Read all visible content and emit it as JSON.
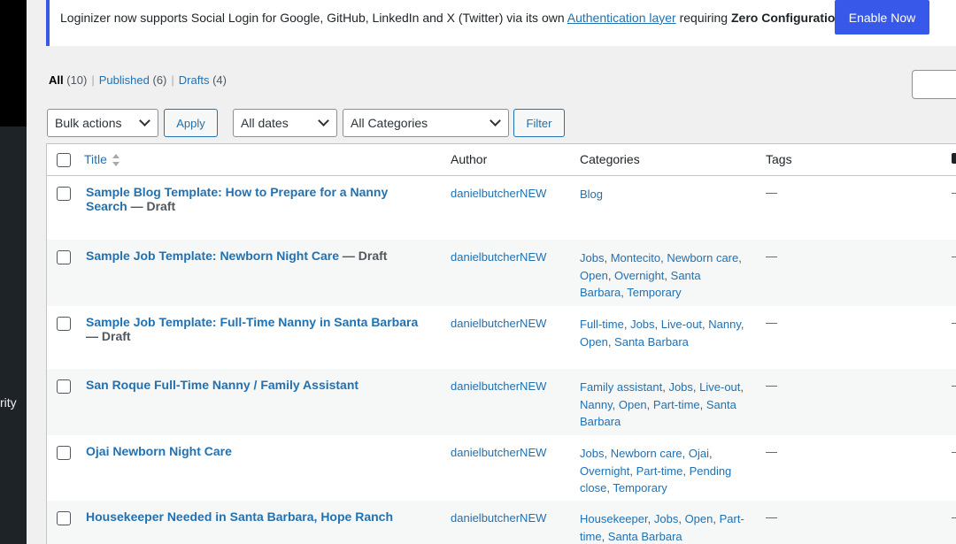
{
  "sidebar": {
    "partial_label": "rity"
  },
  "notice": {
    "text_before": "Loginizer now supports Social Login for Google, GitHub, LinkedIn and X (Twitter) via its own ",
    "link": "Authentication layer",
    "text_middle": " requiring ",
    "bold": "Zero Configuration.",
    "button": "Enable Now"
  },
  "views": {
    "all_label": "All",
    "all_count": "(10)",
    "published_label": "Published",
    "published_count": "(6)",
    "drafts_label": "Drafts",
    "drafts_count": "(4)",
    "sep": "|"
  },
  "controls": {
    "bulk_actions": "Bulk actions",
    "apply": "Apply",
    "dates": "All dates",
    "categories": "All Categories",
    "filter": "Filter"
  },
  "columns": {
    "title": "Title",
    "author": "Author",
    "categories": "Categories",
    "tags": "Tags"
  },
  "rows": [
    {
      "title": "Sample Blog Template: How to Prepare for a Nanny Search",
      "state": " — Draft",
      "author": "danielbutcherNEW",
      "categories": [
        "Blog"
      ],
      "tags": "—"
    },
    {
      "title": "Sample Job Template: Newborn Night Care",
      "state": " — Draft",
      "author": "danielbutcherNEW",
      "categories": [
        "Jobs",
        "Montecito",
        "Newborn care",
        "Open",
        "Overnight",
        "Santa Barbara",
        "Temporary"
      ],
      "tags": "—"
    },
    {
      "title": "Sample Job Template: Full-Time Nanny in Santa Barbara",
      "state": " — Draft",
      "author": "danielbutcherNEW",
      "categories": [
        "Full-time",
        "Jobs",
        "Live-out",
        "Nanny",
        "Open",
        "Santa Barbara"
      ],
      "tags": "—"
    },
    {
      "title": "San Roque Full-Time Nanny / Family Assistant",
      "state": "",
      "author": "danielbutcherNEW",
      "categories": [
        "Family assistant",
        "Jobs",
        "Live-out",
        "Nanny",
        "Open",
        "Part-time",
        "Santa Barbara"
      ],
      "tags": "—"
    },
    {
      "title": "Ojai Newborn Night Care",
      "state": "",
      "author": "danielbutcherNEW",
      "categories": [
        "Jobs",
        "Newborn care",
        "Ojai",
        "Overnight",
        "Part-time",
        "Pending close",
        "Temporary"
      ],
      "tags": "—"
    },
    {
      "title": "Housekeeper Needed in Santa Barbara, Hope Ranch",
      "state": "",
      "author": "danielbutcherNEW",
      "categories": [
        "Housekeeper",
        "Jobs",
        "Open",
        "Part-time",
        "Santa Barbara"
      ],
      "tags": "—"
    }
  ],
  "colors": {
    "accent": "#3858e9",
    "link": "#2271b1",
    "sidebar": "#1d2327"
  }
}
